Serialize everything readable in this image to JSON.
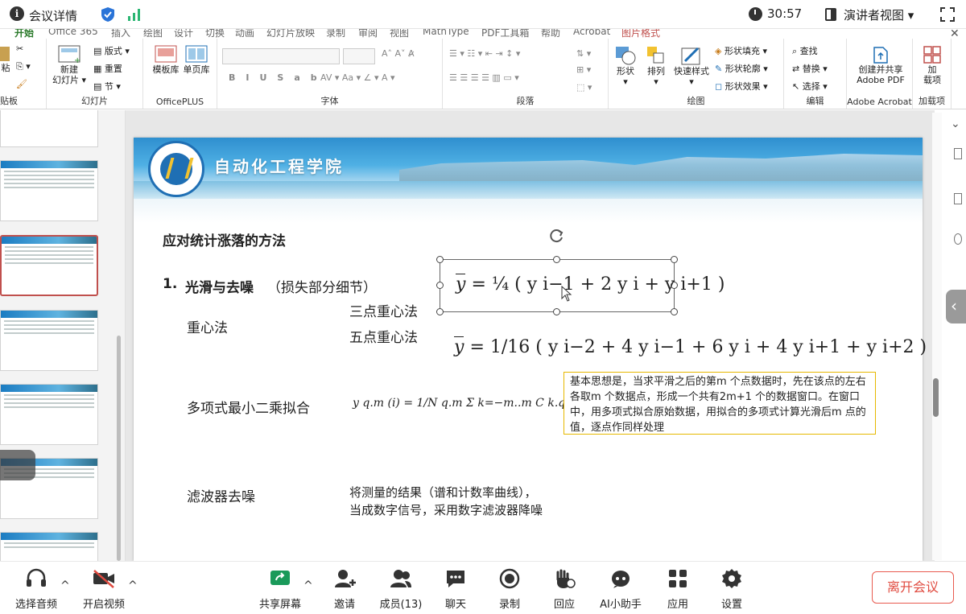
{
  "topbar": {
    "title": "会议详情",
    "time": "30:57",
    "view_label": "演讲者视图 ▾"
  },
  "ribbon": {
    "tabs_cut": [
      "开始",
      "Office 365",
      "插入",
      "绘图",
      "设计",
      "切换",
      "动画",
      "幻灯片放映",
      "录制",
      "审阅",
      "视图",
      "MathType",
      "PDF工具箱",
      "帮助",
      "Acrobat",
      "图片格式"
    ],
    "clipboard": {
      "paste": "粘",
      "group": "贴板"
    },
    "slides": {
      "new": "新建",
      "new2": "幻灯片",
      "layout": "版式",
      "reset": "重置",
      "section": "节",
      "group": "幻灯片"
    },
    "officeplus": {
      "template": "模板库",
      "single": "单页库",
      "group": "OfficePLUS"
    },
    "font": {
      "group": "字体"
    },
    "paragraph": {
      "group": "段落"
    },
    "drawing": {
      "shape": "形状",
      "arrange": "排列",
      "quick": "快速样式",
      "fill": "形状填充",
      "outline": "形状轮廓",
      "effect": "形状效果",
      "group": "绘图"
    },
    "editing": {
      "find": "查找",
      "replace": "替换",
      "select": "选择",
      "group": "编辑"
    },
    "acrobat": {
      "create": "创建并共享",
      "create2": "Adobe PDF",
      "group": "Adobe Acrobat"
    },
    "addins": {
      "add": "加",
      "add2": "载项",
      "group": "加载项"
    }
  },
  "slide": {
    "banner_title": "自动化工程学院",
    "heading": "应对统计涨落的方法",
    "item1_num": "1.",
    "item1_title": "光滑与去噪",
    "item1_note": "（损失部分细节）",
    "centroid": "重心法",
    "three_point": "三点重心法",
    "five_point": "五点重心法",
    "formula1_lhs": "y",
    "formula1_rhs": "= ¼ ( y i−1 + 2 y i + y i+1 )",
    "formula2_rhs": "= 1/16 ( y i−2 + 4 y i−1 + 6 y i + 4 y i+1 + y i+2 )",
    "polyfit": "多项式最小二乘拟合",
    "formula3": "y q.m (i) = 1/N q.m  Σ k=−m..m  C k.q.m y(i+k)",
    "note": "基本思想是，当求平滑之后的第m 个点数据时，先在该点的左右各取m 个数据点，形成一个共有2m+1 个的数据窗口。在窗口中，用多项式拟合原始数据，用拟合的多项式计算光滑后m 点的值，逐点作同样处理",
    "filter": "滤波器去噪",
    "filter_desc1": "将测量的结果（谱和计数率曲线），",
    "filter_desc2": "当成数字信号，采用数字滤波器降噪"
  },
  "bottombar": {
    "audio": "选择音频",
    "video": "开启视频",
    "share": "共享屏幕",
    "invite": "邀请",
    "members": "成员(13)",
    "chat": "聊天",
    "record": "录制",
    "reply": "回应",
    "ai": "AI小助手",
    "apps": "应用",
    "settings": "设置",
    "leave": "离开会议"
  },
  "colors": {
    "accent": "#1f6fb4",
    "leave": "#e04a3f",
    "note_border": "#e6b800",
    "selected_thumb": "#c0504d"
  }
}
